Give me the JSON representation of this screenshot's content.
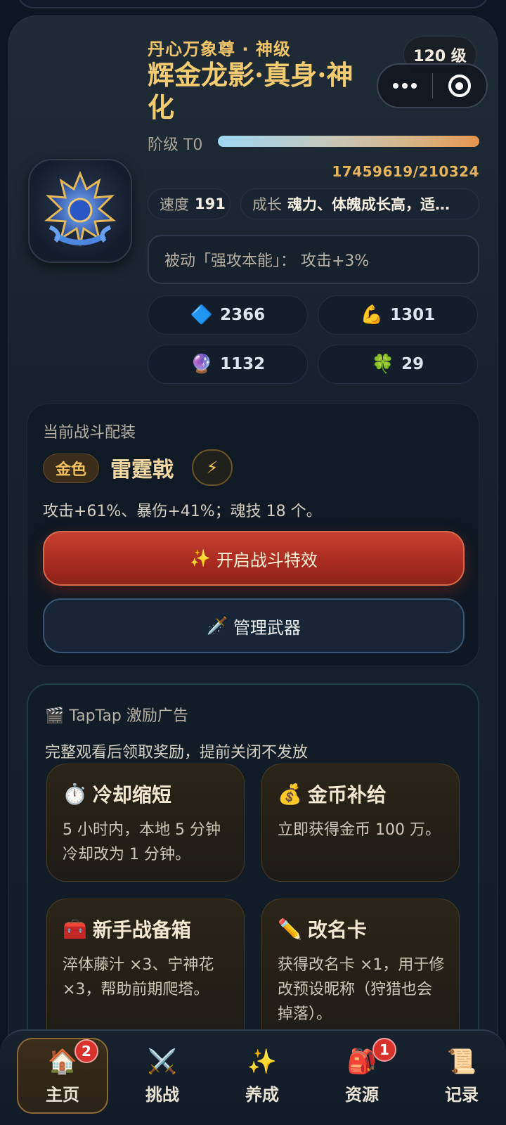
{
  "hero": {
    "subtitle": "丹心万象尊 · 神级",
    "name": "辉金龙影·真身·神化",
    "level": "120 级",
    "rank_label": "阶级 T0",
    "exp": "17459619/210324",
    "speed_label": "速度",
    "speed_value": "191",
    "growth_label": "成长",
    "growth_value": "魂力、体魄成长高，适…",
    "passive": "被动「强攻本能」： 攻击+3%",
    "stats": [
      {
        "icon": "🔷",
        "value": "2366"
      },
      {
        "icon": "💪",
        "value": "1301"
      },
      {
        "icon": "🔮",
        "value": "1132"
      },
      {
        "icon": "🍀",
        "value": "29"
      }
    ]
  },
  "battle": {
    "header": "当前战斗配装",
    "quality_tag": "金色",
    "weapon_name": "雷霆戟",
    "bolt_icon": "⚡",
    "description": "攻击+61%、暴伤+41%；魂技 18 个。",
    "effect_button": "开启战斗特效",
    "effect_icon": "✨",
    "manage_button": "管理武器",
    "manage_icon": "🗡️"
  },
  "ad": {
    "header_icon": "🎬",
    "header": "TapTap 激励广告",
    "subtitle": "完整观看后领取奖励，提前关闭不发放",
    "rewards": [
      {
        "icon": "⏱️",
        "title": "冷却缩短",
        "desc": "5 小时内，本地 5 分钟冷却改为 1 分钟。"
      },
      {
        "icon": "💰",
        "title": "金币补给",
        "desc": "立即获得金币 100 万。"
      },
      {
        "icon": "🧰",
        "title": "新手战备箱",
        "desc": "淬体藤汁 ×3、宁神花 ×3，帮助前期爬塔。"
      },
      {
        "icon": "✏️",
        "title": "改名卡",
        "desc": "获得改名卡 ×1，用于修改预设昵称（狩猎也会掉落）。"
      }
    ]
  },
  "nav": {
    "items": [
      {
        "icon": "🏠",
        "label": "主页",
        "badge": "2"
      },
      {
        "icon": "⚔️",
        "label": "挑战"
      },
      {
        "icon": "✨",
        "label": "养成"
      },
      {
        "icon": "🎒",
        "label": "资源",
        "badge": "1"
      },
      {
        "icon": "📜",
        "label": "记录"
      }
    ]
  },
  "colors": {
    "accent_gold": "#f3cb70",
    "primary_red": "#c63f31",
    "background": "#0d1722"
  }
}
